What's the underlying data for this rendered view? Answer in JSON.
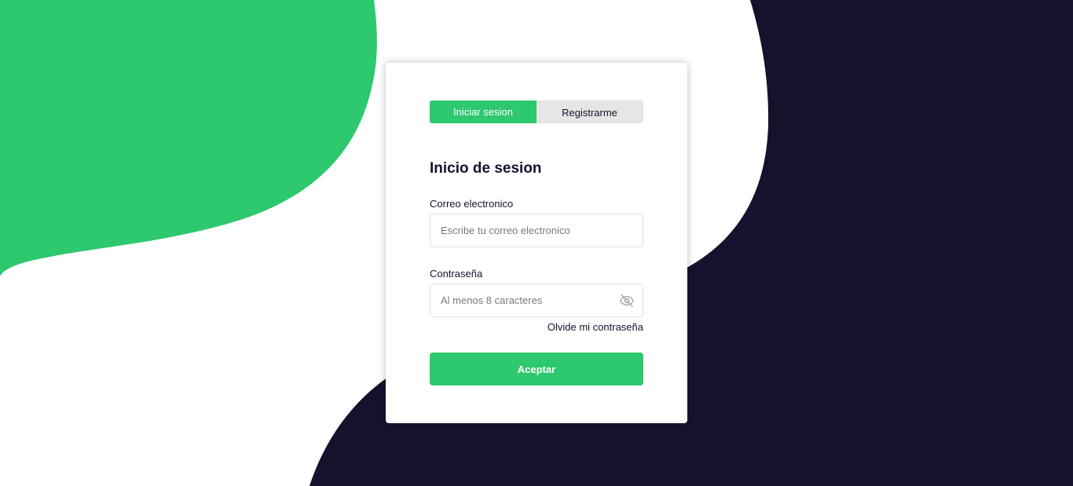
{
  "colors": {
    "accent": "#2ec86e",
    "dark": "#14122d",
    "tab_inactive": "#e6e6e6",
    "background": "#ffffff"
  },
  "tabs": {
    "login_label": "Iniciar sesion",
    "register_label": "Registrarme",
    "active": "login"
  },
  "form": {
    "heading": "Inicio de sesion",
    "email": {
      "label": "Correo electronico",
      "placeholder": "Escribe tu correo electronico",
      "value": ""
    },
    "password": {
      "label": "Contraseña",
      "placeholder": "Al menos 8 caracteres",
      "value": "",
      "toggle_icon": "eye-off-icon"
    },
    "forgot_label": "Olvide mi contraseña",
    "submit_label": "Aceptar"
  }
}
